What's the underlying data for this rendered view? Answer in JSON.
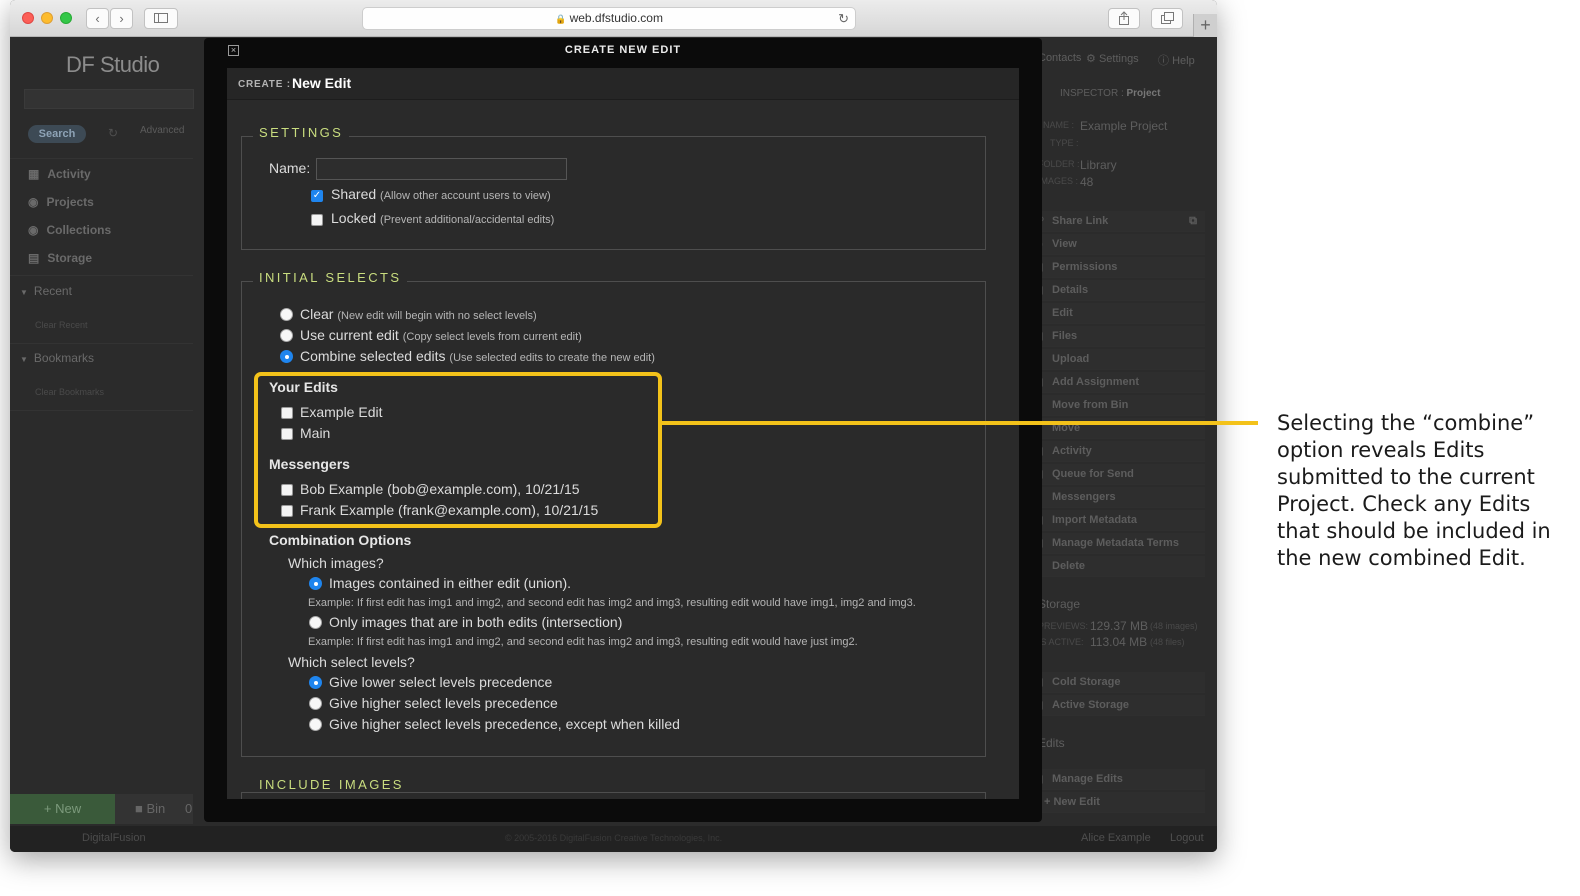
{
  "browser": {
    "url": "web.dfstudio.com",
    "back_icon": "chevron-left",
    "forward_icon": "chevron-right"
  },
  "app": {
    "logo": "DF Studio",
    "sidebar": {
      "search_label": "Search",
      "advanced_label": "Advanced",
      "items": [
        "Activity",
        "Projects",
        "Collections",
        "Storage"
      ],
      "recent": "Recent",
      "clear_recent": "Clear Recent",
      "bookmarks": "Bookmarks",
      "clear_bookmarks": "Clear Bookmarks",
      "new_label": "+ New",
      "bin_label": "Bin",
      "bin_count": "0"
    },
    "topnav": [
      "Contacts",
      "Settings",
      "Help"
    ],
    "inspector": {
      "prefix": "INSPECTOR :",
      "title": "Project",
      "name_key": "NAME :",
      "name_val": "Example Project",
      "type_key": "TYPE :",
      "folder_key": "FOLDER :",
      "folder_val": "Library",
      "images_key": "IMAGES :",
      "images_val": "48",
      "actions": [
        "Share Link",
        "View",
        "Permissions",
        "Details",
        "Edit",
        "Files",
        "Upload",
        "Add Assignment",
        "Move from Bin",
        "Move",
        "Activity",
        "Queue for Send",
        "Messengers",
        "Import Metadata",
        "Manage Metadata Terms",
        "Delete"
      ],
      "storage_hdr": "Storage",
      "previews_key": "PREVIEWS:",
      "previews_val": "129.37 MB",
      "previews_note": "(48 images)",
      "active_key": "IS ACTIVE:",
      "active_val": "113.04 MB",
      "active_note": "(48 files)",
      "storage_actions": [
        "Cold Storage",
        "Active Storage"
      ],
      "edits_hdr": "Edits",
      "edit_actions": [
        "Manage Edits",
        "+ New Edit"
      ]
    },
    "footer": {
      "brand": "DigitalFusion",
      "copyright": "© 2005-2016 DigitalFusion Creative Technologies, Inc.",
      "user": "Alice Example",
      "logout": "Logout"
    }
  },
  "modal": {
    "title": "CREATE NEW EDIT",
    "create_prefix": "CREATE :",
    "create_name": "New Edit",
    "settings": {
      "legend": "SETTINGS",
      "name_label": "Name:",
      "name_value": "",
      "shared_label": "Shared",
      "shared_hint": "(Allow other account users to view)",
      "shared_checked": true,
      "locked_label": "Locked",
      "locked_hint": "(Prevent additional/accidental edits)",
      "locked_checked": false
    },
    "initial_selects": {
      "legend": "INITIAL SELECTS",
      "options": [
        {
          "label": "Clear",
          "hint": "(New edit will begin with no select levels)",
          "selected": false
        },
        {
          "label": "Use current edit",
          "hint": "(Copy select levels from current edit)",
          "selected": false
        },
        {
          "label": "Combine selected edits",
          "hint": "(Use selected edits to create the new edit)",
          "selected": true
        }
      ],
      "your_edits_header": "Your Edits",
      "your_edits": [
        "Example Edit",
        "Main"
      ],
      "messengers_header": "Messengers",
      "messengers": [
        "Bob Example (bob@example.com), 10/21/15",
        "Frank Example (frank@example.com), 10/21/15"
      ],
      "combination_header": "Combination Options",
      "which_images": "Which images?",
      "image_options": [
        {
          "label": "Images contained in either edit (union).",
          "example": "Example: If first edit has img1 and img2, and second edit has img2 and img3, resulting edit would have img1, img2 and img3.",
          "selected": true
        },
        {
          "label": "Only images that are in both edits (intersection)",
          "example": "Example: If first edit has img1 and img2, and second edit has img2 and img3, resulting edit would have just img2.",
          "selected": false
        }
      ],
      "which_levels": "Which select levels?",
      "level_options": [
        {
          "label": "Give lower select levels precedence",
          "selected": true
        },
        {
          "label": "Give higher select levels precedence",
          "selected": false
        },
        {
          "label": "Give higher select levels precedence, except when killed",
          "selected": false
        }
      ]
    },
    "include_images_legend": "INCLUDE IMAGES"
  },
  "annotation": {
    "text": "Selecting the “combine” option reveals Edits submitted to the current Project. Check any Edits that should be included in the new combined Edit."
  },
  "colors": {
    "highlight": "#f3c21a",
    "legend": "#c9dd7f",
    "accent": "#1f85ee"
  }
}
